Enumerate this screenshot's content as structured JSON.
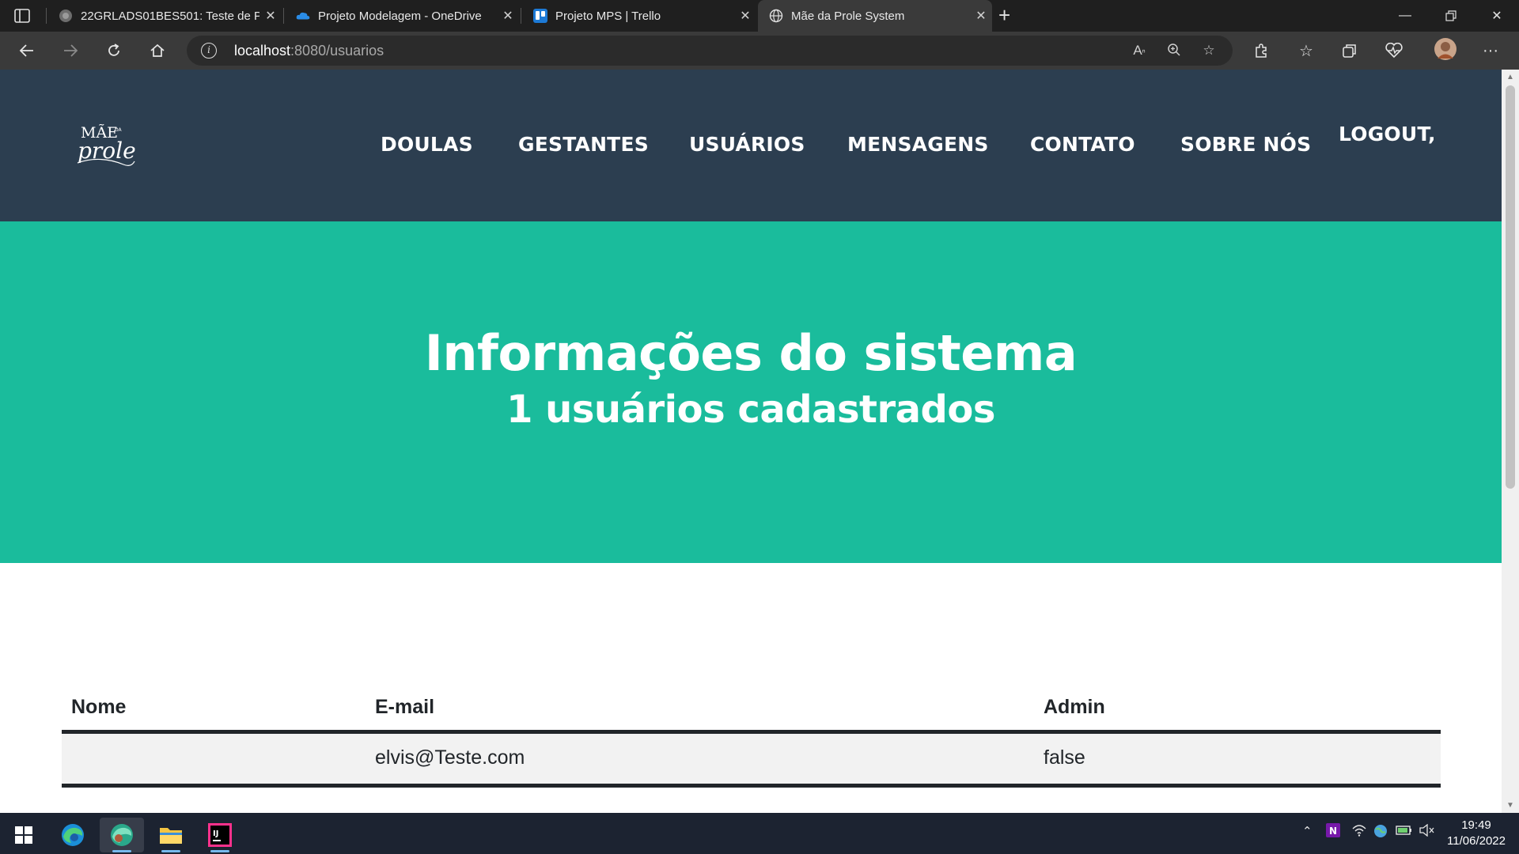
{
  "browser": {
    "tabs": [
      {
        "title": "22GRLADS01BES501: Teste de Pe",
        "icon": "moodle-icon"
      },
      {
        "title": "Projeto Modelagem - OneDrive",
        "icon": "onedrive-icon"
      },
      {
        "title": "Projeto MPS | Trello",
        "icon": "trello-icon"
      },
      {
        "title": "Mãe da Prole System",
        "icon": "globe-icon"
      }
    ],
    "url_host": "localhost",
    "url_rest": ":8080/usuarios"
  },
  "site": {
    "logo": {
      "line1": "MÃE",
      "small": "DA",
      "line2": "prole"
    },
    "nav": [
      "DOULAS",
      "GESTANTES",
      "USUÁRIOS",
      "MENSAGENS",
      "CONTATO",
      "SOBRE NÓS"
    ],
    "logout": "LOGOUT,"
  },
  "hero": {
    "title": "Informações do sistema",
    "subtitle": "1 usuários cadastrados"
  },
  "table": {
    "headers": [
      "Nome",
      "E-mail",
      "Admin"
    ],
    "rows": [
      [
        "",
        "elvis@Teste.com",
        "false"
      ]
    ]
  },
  "taskbar": {
    "time": "19:49",
    "date": "11/06/2022"
  },
  "colors": {
    "nav_bg": "#2c3e50",
    "hero_bg": "#1abc9c",
    "text": "#212529"
  }
}
